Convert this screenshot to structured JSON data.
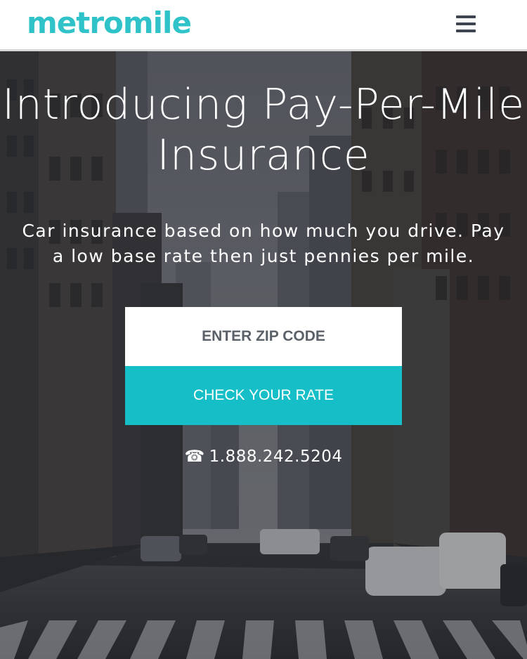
{
  "header": {
    "logo_text": "metromile",
    "menu_icon": "hamburger-menu-icon"
  },
  "hero": {
    "headline_line1": "Introducing Pay-Per-Mile",
    "headline_line2": "Insurance",
    "subhead": "Car insurance based on how much you drive. Pay a low base rate then just pennies per mile.",
    "zip_placeholder": "ENTER ZIP CODE",
    "cta_label": "CHECK YOUR RATE",
    "phone_icon": "phone-icon",
    "phone_number": "1.888.242.5204"
  },
  "colors": {
    "brand": "#2fc3c9",
    "cta_background": "#16bfc8",
    "menu_icon": "#3e4550"
  }
}
